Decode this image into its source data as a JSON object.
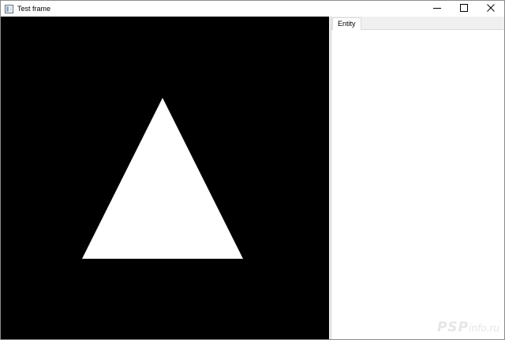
{
  "window": {
    "title": "Test frame",
    "icons": {
      "app": "app-window-icon",
      "minimize": "minimize-icon",
      "maximize": "maximize-icon",
      "close": "close-icon"
    }
  },
  "viewport": {
    "background_color": "#000000",
    "shape": "triangle",
    "shape_color": "#ffffff"
  },
  "side_panel": {
    "tabs": [
      {
        "label": "Entity",
        "active": true
      }
    ]
  },
  "watermark": {
    "main": "PSP",
    "suffix": "info.ru"
  }
}
